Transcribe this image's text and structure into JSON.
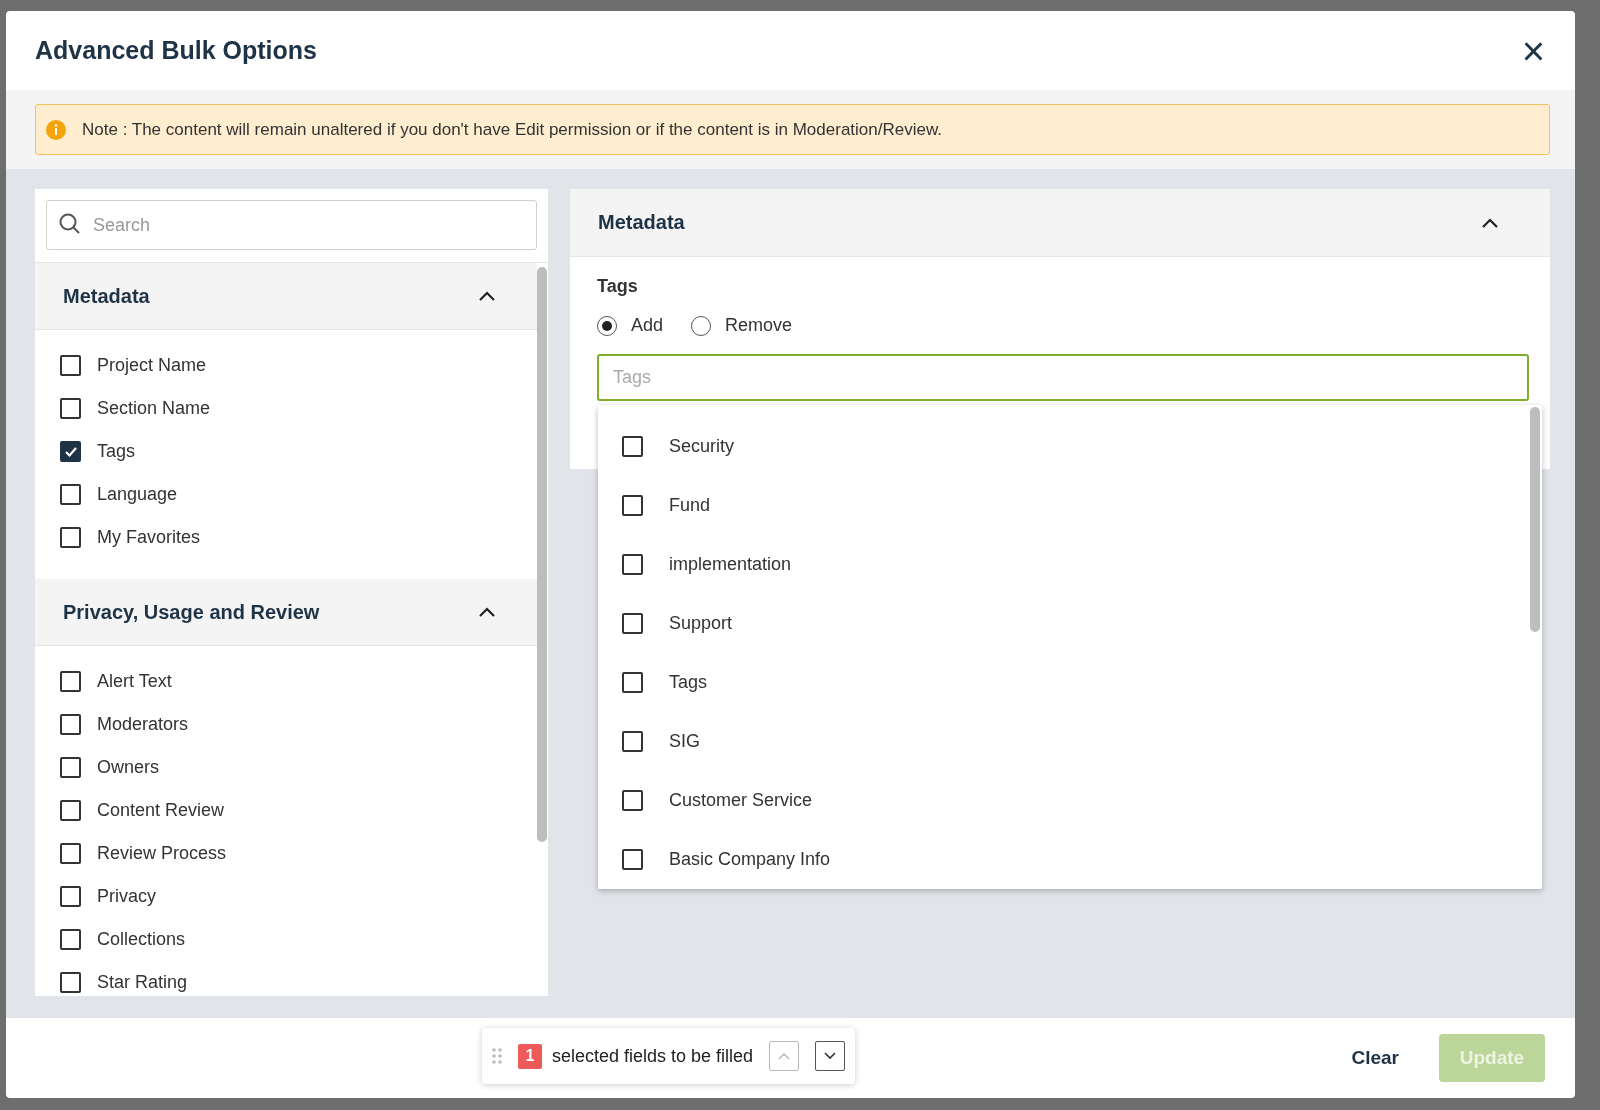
{
  "dialog": {
    "title": "Advanced Bulk Options",
    "close": "×"
  },
  "note": {
    "label": "Note :",
    "text": "The content will remain unaltered if you don't have Edit permission or if the content is in Moderation/Review."
  },
  "field_list": {
    "search": {
      "placeholder": "Search"
    },
    "sections": [
      {
        "title": "Metadata",
        "expanded": true,
        "items": [
          {
            "label": "Project Name",
            "checked": false
          },
          {
            "label": "Section Name",
            "checked": false
          },
          {
            "label": "Tags",
            "checked": true
          },
          {
            "label": "Language",
            "checked": false
          },
          {
            "label": "My Favorites",
            "checked": false
          }
        ]
      },
      {
        "title": "Privacy, Usage and Review",
        "expanded": true,
        "items": [
          {
            "label": "Alert Text",
            "checked": false
          },
          {
            "label": "Moderators",
            "checked": false
          },
          {
            "label": "Owners",
            "checked": false
          },
          {
            "label": "Content Review",
            "checked": false
          },
          {
            "label": "Review Process",
            "checked": false
          },
          {
            "label": "Privacy",
            "checked": false
          },
          {
            "label": "Collections",
            "checked": false
          },
          {
            "label": "Star Rating",
            "checked": false
          }
        ]
      }
    ]
  },
  "editor": {
    "title": "Metadata",
    "expanded": true,
    "field_label": "Tags",
    "modes": [
      {
        "label": "Add",
        "selected": true
      },
      {
        "label": "Remove",
        "selected": false
      }
    ],
    "input": {
      "placeholder": "Tags",
      "focused": true
    },
    "options": [
      {
        "label": "Security",
        "checked": false
      },
      {
        "label": "Fund",
        "checked": false
      },
      {
        "label": "implementation",
        "checked": false
      },
      {
        "label": "Support",
        "checked": false
      },
      {
        "label": "Tags",
        "checked": false
      },
      {
        "label": "SIG",
        "checked": false
      },
      {
        "label": "Customer Service",
        "checked": false
      },
      {
        "label": "Basic Company Info",
        "checked": false
      }
    ]
  },
  "footer": {
    "count": "1",
    "count_text": "selected fields to be filled",
    "prev_disabled": true,
    "next_disabled": false,
    "clear": "Clear",
    "update": {
      "label": "Update",
      "disabled": true
    }
  }
}
